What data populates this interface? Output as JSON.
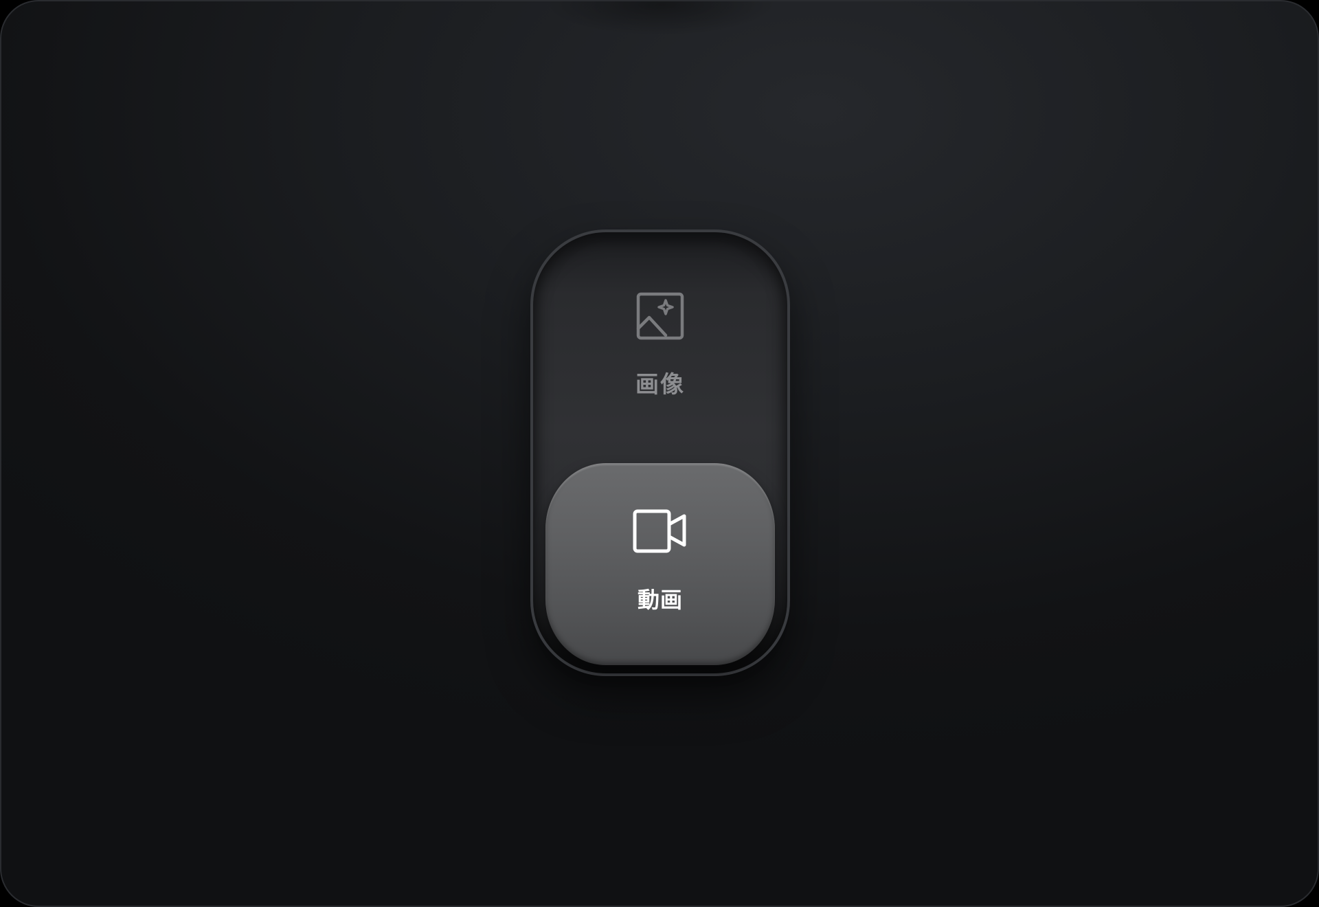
{
  "switcher": {
    "options": [
      {
        "label": "画像",
        "icon": "image-sparkle-icon",
        "selected": false
      },
      {
        "label": "動画",
        "icon": "video-camera-icon",
        "selected": true
      }
    ]
  },
  "colors": {
    "inactive_label": "#8d8e91",
    "active_label": "#ffffff",
    "selected_segment": "#5e5f61"
  }
}
